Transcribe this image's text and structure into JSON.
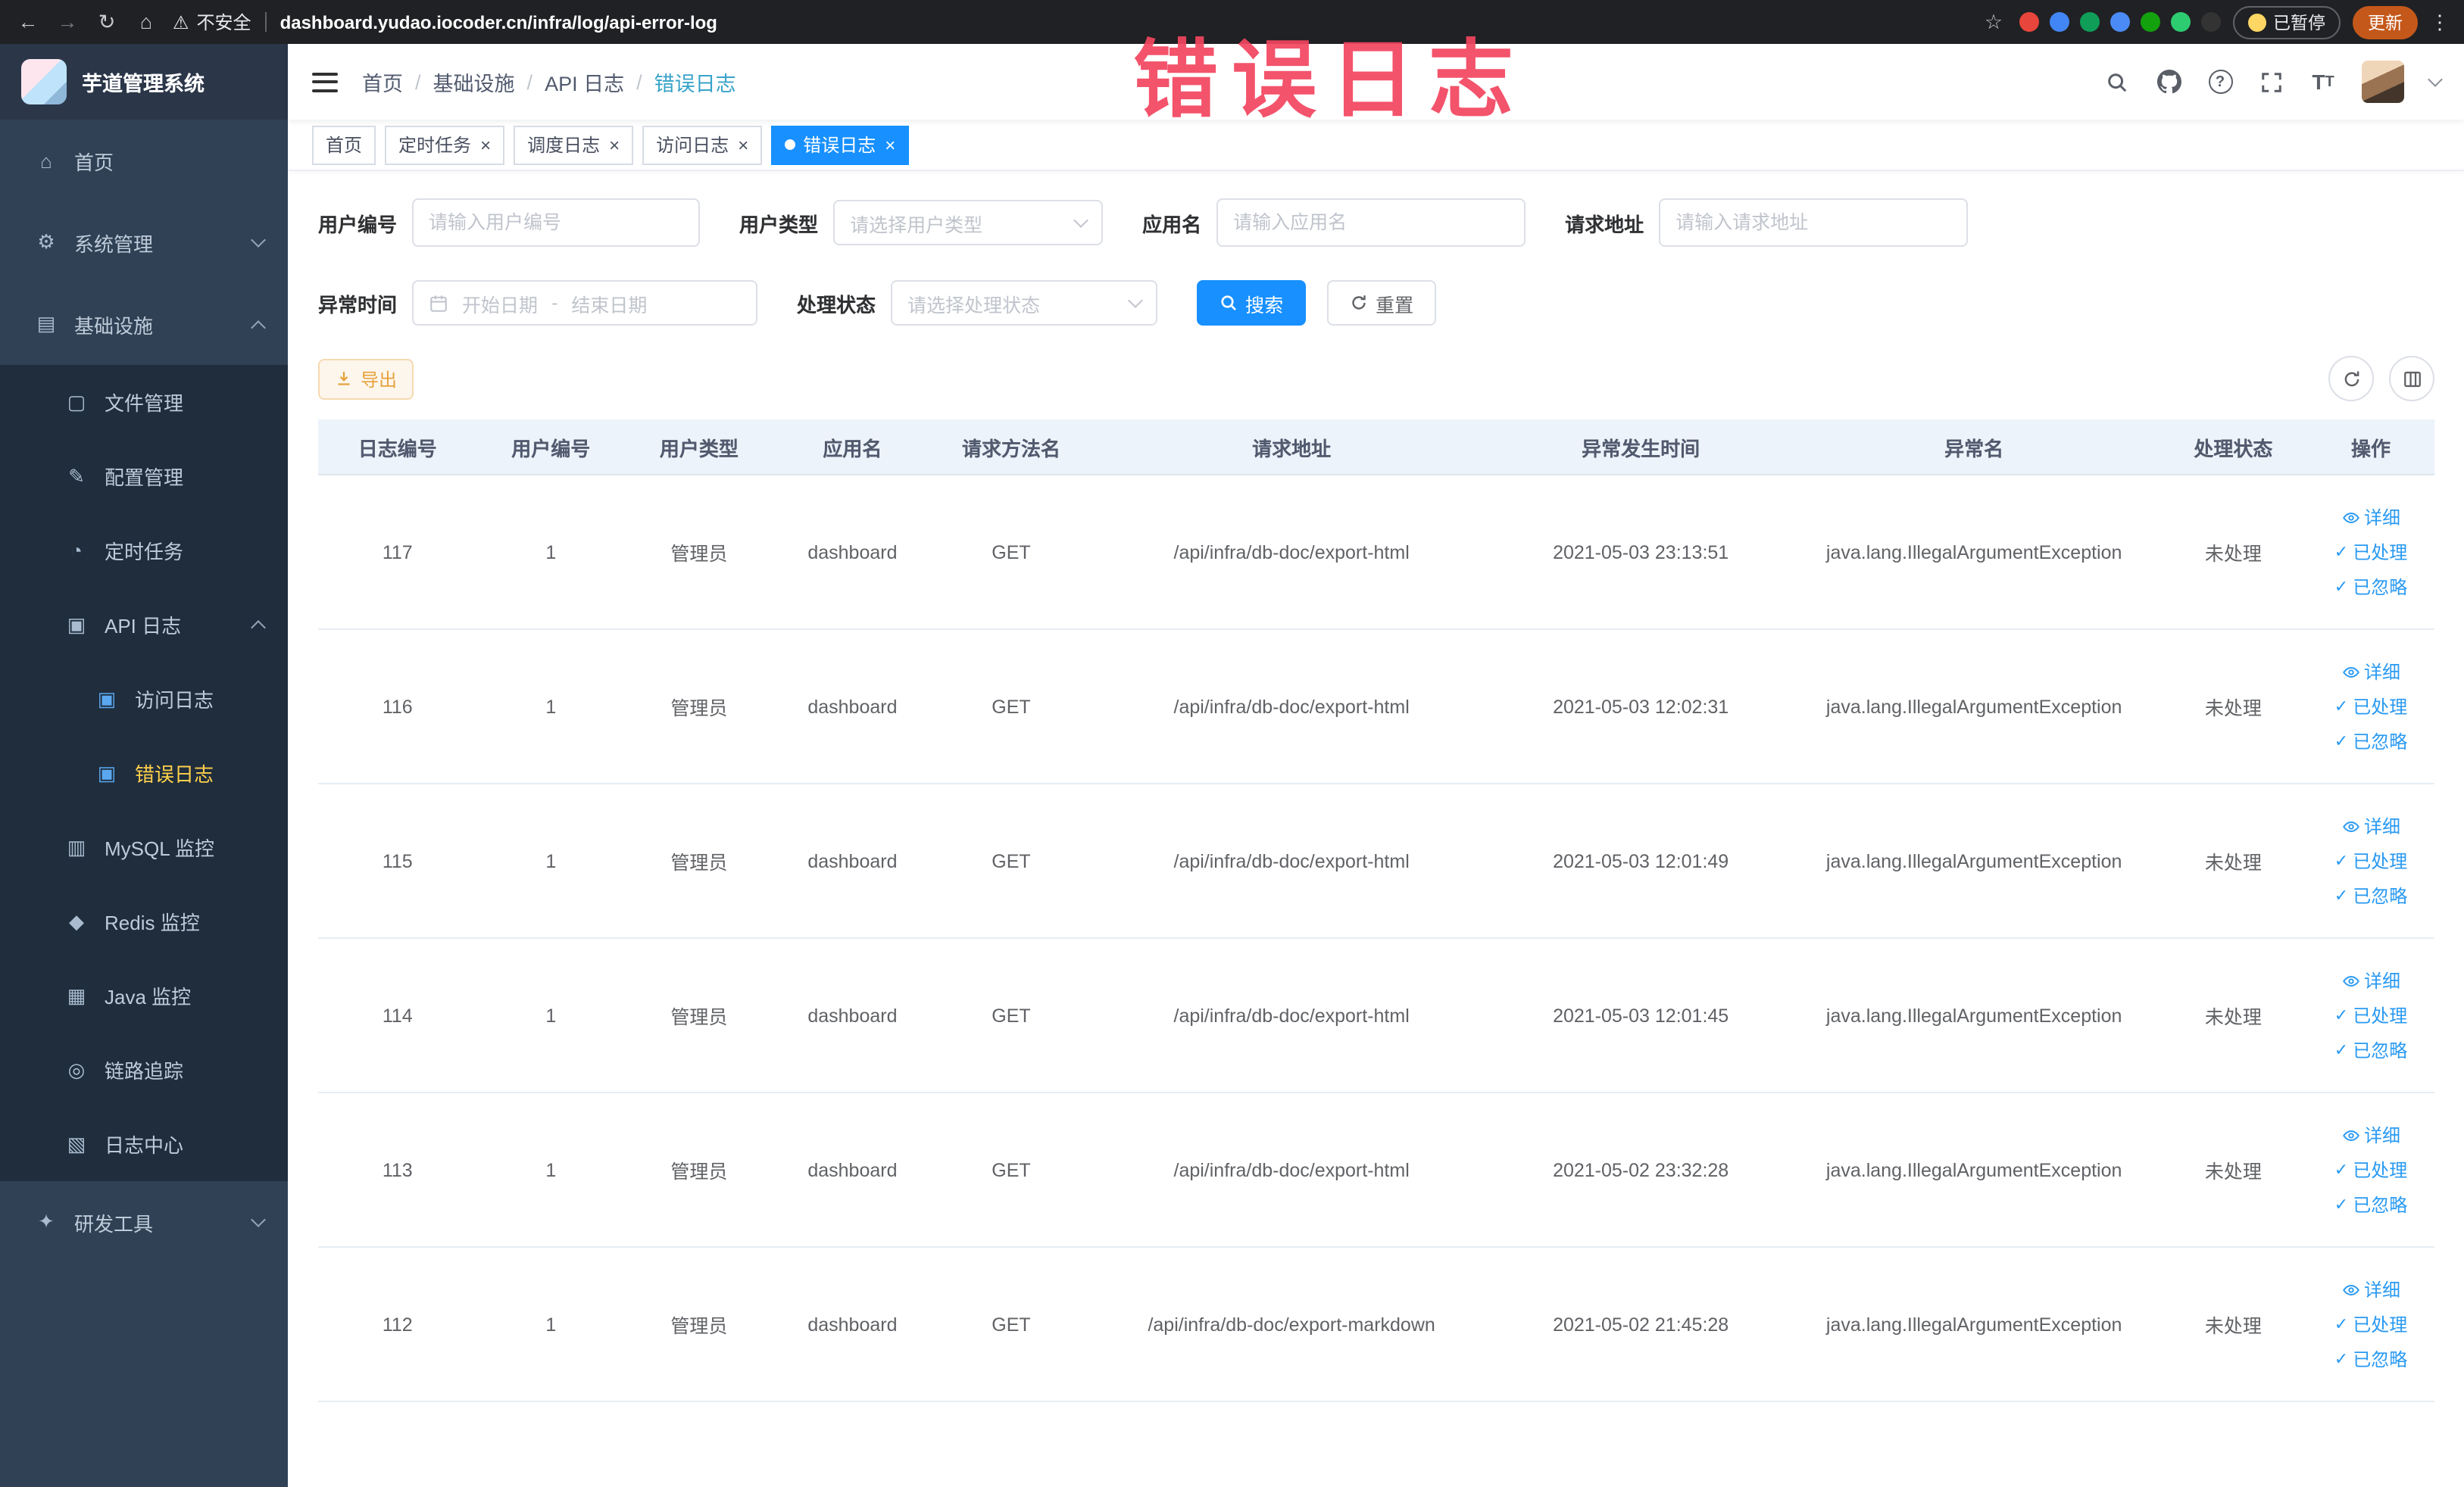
{
  "annotation": {
    "text": "错误日志",
    "color": "#f2455f"
  },
  "colors": {
    "primary": "#1890ff",
    "warning": "#e6a23c",
    "sidebar_active": "#ffd04b"
  },
  "browser": {
    "security_label": "不安全",
    "url": "dashboard.yudao.iocoder.cn/infra/log/api-error-log",
    "paused_label": "已暂停",
    "update_label": "更新",
    "extension_colors": [
      "#e8453c",
      "#4285f4",
      "#0f9d58",
      "#4b8bf5",
      "#13a10e",
      "#2ecc71",
      "#333333"
    ]
  },
  "sidebar": {
    "logo_title": "芋道管理系统",
    "items": [
      {
        "key": "home",
        "label": "首页",
        "level": 1,
        "icon": "home"
      },
      {
        "key": "system-mgmt",
        "label": "系统管理",
        "level": 1,
        "icon": "gear",
        "chevron": "down"
      },
      {
        "key": "infrastructure",
        "label": "基础设施",
        "level": 1,
        "icon": "infra",
        "chevron": "up"
      },
      {
        "key": "file-mgmt",
        "label": "文件管理",
        "level": 2,
        "icon": "file"
      },
      {
        "key": "config-mgmt",
        "label": "配置管理",
        "level": 2,
        "icon": "config"
      },
      {
        "key": "scheduled-jobs",
        "label": "定时任务",
        "level": 2,
        "icon": "timer"
      },
      {
        "key": "api-logs",
        "label": "API 日志",
        "level": 2,
        "icon": "api-log",
        "chevron": "up"
      },
      {
        "key": "access-log",
        "label": "访问日志",
        "level": 3,
        "icon": "access-log"
      },
      {
        "key": "error-log",
        "label": "错误日志",
        "level": 3,
        "icon": "error-log",
        "active": true
      },
      {
        "key": "mysql-monitor",
        "label": "MySQL 监控",
        "level": 2,
        "icon": "mysql"
      },
      {
        "key": "redis-monitor",
        "label": "Redis 监控",
        "level": 2,
        "icon": "redis"
      },
      {
        "key": "java-monitor",
        "label": "Java 监控",
        "level": 2,
        "icon": "java"
      },
      {
        "key": "tracing",
        "label": "链路追踪",
        "level": 2,
        "icon": "trace"
      },
      {
        "key": "log-center",
        "label": "日志中心",
        "level": 2,
        "icon": "log-center"
      },
      {
        "key": "dev-tools",
        "label": "研发工具",
        "level": 1,
        "icon": "tools",
        "chevron": "down"
      }
    ]
  },
  "header": {
    "breadcrumb": [
      "首页",
      "基础设施",
      "API 日志",
      "错误日志"
    ]
  },
  "tabs": [
    {
      "key": "home",
      "label": "首页",
      "closable": false,
      "active": false
    },
    {
      "key": "scheduled-jobs",
      "label": "定时任务",
      "closable": true,
      "active": false
    },
    {
      "key": "job-log",
      "label": "调度日志",
      "closable": true,
      "active": false
    },
    {
      "key": "access-log",
      "label": "访问日志",
      "closable": true,
      "active": false
    },
    {
      "key": "error-log",
      "label": "错误日志",
      "closable": true,
      "active": true
    }
  ],
  "filters": {
    "user_id": {
      "label": "用户编号",
      "placeholder": "请输入用户编号"
    },
    "user_type": {
      "label": "用户类型",
      "placeholder": "请选择用户类型"
    },
    "app_name": {
      "label": "应用名",
      "placeholder": "请输入应用名"
    },
    "request_url": {
      "label": "请求地址",
      "placeholder": "请输入请求地址"
    },
    "exception_time": {
      "label": "异常时间",
      "start_placeholder": "开始日期",
      "separator": "-",
      "end_placeholder": "结束日期"
    },
    "process_status": {
      "label": "处理状态",
      "placeholder": "请选择处理状态"
    },
    "search_label": "搜索",
    "reset_label": "重置"
  },
  "toolbar": {
    "export_label": "导出"
  },
  "table": {
    "columns": [
      "日志编号",
      "用户编号",
      "用户类型",
      "应用名",
      "请求方法名",
      "请求地址",
      "异常发生时间",
      "异常名",
      "处理状态",
      "操作"
    ],
    "actions": [
      "详细",
      "已处理",
      "已忽略"
    ],
    "rows": [
      {
        "id": "117",
        "user_id": "1",
        "user_type": "管理员",
        "app": "dashboard",
        "method": "GET",
        "url": "/api/infra/db-doc/export-html",
        "time": "2021-05-03 23:13:51",
        "exception": "java.lang.IllegalArgumentException",
        "status": "未处理"
      },
      {
        "id": "116",
        "user_id": "1",
        "user_type": "管理员",
        "app": "dashboard",
        "method": "GET",
        "url": "/api/infra/db-doc/export-html",
        "time": "2021-05-03 12:02:31",
        "exception": "java.lang.IllegalArgumentException",
        "status": "未处理"
      },
      {
        "id": "115",
        "user_id": "1",
        "user_type": "管理员",
        "app": "dashboard",
        "method": "GET",
        "url": "/api/infra/db-doc/export-html",
        "time": "2021-05-03 12:01:49",
        "exception": "java.lang.IllegalArgumentException",
        "status": "未处理"
      },
      {
        "id": "114",
        "user_id": "1",
        "user_type": "管理员",
        "app": "dashboard",
        "method": "GET",
        "url": "/api/infra/db-doc/export-html",
        "time": "2021-05-03 12:01:45",
        "exception": "java.lang.IllegalArgumentException",
        "status": "未处理"
      },
      {
        "id": "113",
        "user_id": "1",
        "user_type": "管理员",
        "app": "dashboard",
        "method": "GET",
        "url": "/api/infra/db-doc/export-html",
        "time": "2021-05-02 23:32:28",
        "exception": "java.lang.IllegalArgumentException",
        "status": "未处理"
      },
      {
        "id": "112",
        "user_id": "1",
        "user_type": "管理员",
        "app": "dashboard",
        "method": "GET",
        "url": "/api/infra/db-doc/export-markdown",
        "time": "2021-05-02 21:45:28",
        "exception": "java.lang.IllegalArgumentException",
        "status": "未处理"
      }
    ]
  }
}
